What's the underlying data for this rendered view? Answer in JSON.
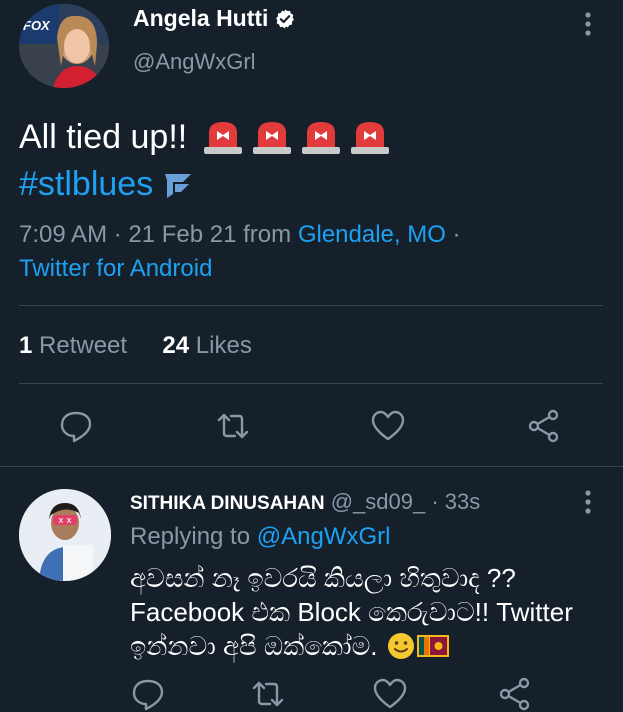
{
  "tweet": {
    "author_name": "Angela Hutti",
    "author_handle": "@AngWxGrl",
    "avatar_logo_text": "FOX",
    "text": "All tied up!!",
    "hashtag": "#stlblues",
    "time": "7:09 AM · 21 Feb 21 from ",
    "location": "Glendale, MO",
    "location_sep": " ·",
    "source": "Twitter for Android",
    "retweet_count": "1",
    "retweet_label": "Retweet",
    "like_count": "24",
    "like_label": "Likes"
  },
  "reply": {
    "author_name": "SITHIKA DINUSAHAN",
    "author_handle": "@_sd09_",
    "time": "· 33s",
    "replying_prefix": "Replying to ",
    "replying_handle": "@AngWxGrl",
    "text_line1": "අවසන් නෑ ඉවරයි කියලා හිතුවාද ??",
    "text_line2": "Facebook එක Block කෙරුවාට!! Twitter",
    "text_line3": "ඉන්නවා අපි ඔක්කෝම."
  },
  "icons": [
    "verified-icon",
    "more-icon",
    "siren-emoji",
    "blues-note-icon",
    "reply-icon",
    "retweet-icon",
    "like-icon",
    "share-icon",
    "smiley-emoji",
    "sri-lanka-flag-emoji"
  ],
  "colors": {
    "background": "#15202b",
    "accent": "#1da1f2",
    "secondary_text": "#8899a6",
    "divider": "#38444d"
  }
}
